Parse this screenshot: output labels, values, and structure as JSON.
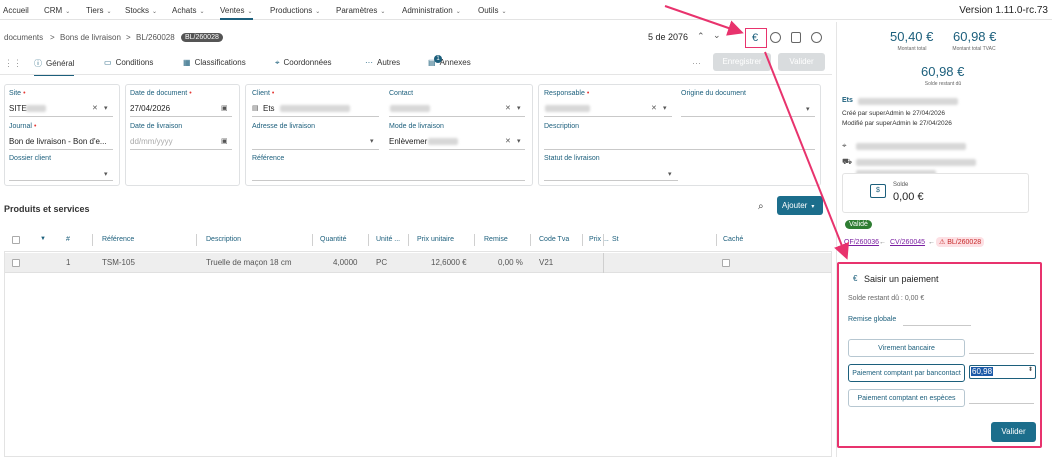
{
  "nav": {
    "items": [
      {
        "label": "Accueil"
      },
      {
        "label": "CRM"
      },
      {
        "label": "Tiers"
      },
      {
        "label": "Stocks"
      },
      {
        "label": "Achats"
      },
      {
        "label": "Ventes"
      },
      {
        "label": "Productions"
      },
      {
        "label": "Paramètres"
      },
      {
        "label": "Administration"
      },
      {
        "label": "Outils"
      }
    ],
    "version": "Version 1.11.0-rc.73"
  },
  "breadcrumb": {
    "items": [
      "documents",
      ">",
      "Bons de livraison",
      ">",
      "BL/260028"
    ],
    "badge": "BL/260028"
  },
  "pager": {
    "text": "5 de 2076"
  },
  "icons": {
    "euro": "€"
  },
  "tabs": [
    {
      "label": "Général"
    },
    {
      "label": "Conditions"
    },
    {
      "label": "Classifications"
    },
    {
      "label": "Coordonnées"
    },
    {
      "label": "Autres"
    },
    {
      "label": "Annexes",
      "count": "1"
    }
  ],
  "actions": {
    "more": "···",
    "save": "Enregistrer",
    "validate": "Valider"
  },
  "form": {
    "site_label": "Site",
    "site_value": "SITE",
    "journal_label": "Journal",
    "journal_value": "Bon de livraison - Bon d'e...",
    "dossier_label": "Dossier client",
    "date_doc_label": "Date de document",
    "date_doc_value": "27/04/2026",
    "date_liv_label": "Date de livraison",
    "date_liv_placeholder": "dd/mm/yyyy",
    "client_label": "Client",
    "client_value": "Ets",
    "contact_label": "Contact",
    "adresse_label": "Adresse de livraison",
    "mode_label": "Mode de livraison",
    "mode_value": "Enlèvemer",
    "reference_label": "Référence",
    "responsable_label": "Responsable",
    "origine_label": "Origine du document",
    "description_label": "Description",
    "statut_label": "Statut de livraison"
  },
  "products": {
    "title": "Produits et services",
    "add_label": "Ajouter",
    "headers": [
      "#",
      "Référence",
      "Description",
      "Quantité",
      "Unité ...",
      "Prix unitaire",
      "Remise",
      "Code Tva",
      "Prix ...",
      "St",
      "Caché"
    ],
    "rows": [
      {
        "num": "1",
        "ref": "TSM-105",
        "desc": "Truelle de maçon 18 cm",
        "qty": "4,0000",
        "unit": "PC",
        "price": "12,6000 €",
        "remise": "0,00 %",
        "tva": "V21"
      }
    ]
  },
  "summary": {
    "total": "50,40 €",
    "total_label": "Montant total",
    "total_tvac": "60,98 €",
    "total_tvac_label": "Montant total TVAC",
    "solde": "60,98 €",
    "solde_label": "Solde restant dû",
    "company": "Ets",
    "created": "Créé par superAdmin le 27/04/2026",
    "modified": "Modifié par superAdmin le 27/04/2026",
    "solde_box_label": "Solde",
    "solde_box_value": "0,00 €",
    "status_badge": "Validé",
    "links": [
      "OF/260036",
      "←",
      "CV/260045",
      "←",
      "BL/260028"
    ]
  },
  "payment": {
    "title": "Saisir un paiement",
    "back_icon": "€",
    "remaining": "Solde restant dû : 0,00 €",
    "remise_label": "Remise globale",
    "methods": [
      "Virement bancaire",
      "Paiement comptant par bancontact",
      "Paiement comptant en espèces"
    ],
    "amount_value": "60,98",
    "submit": "Valider"
  },
  "colors": {
    "accent": "#1c5f7c",
    "highlight": "#e8336d",
    "success": "#2e7d32"
  }
}
